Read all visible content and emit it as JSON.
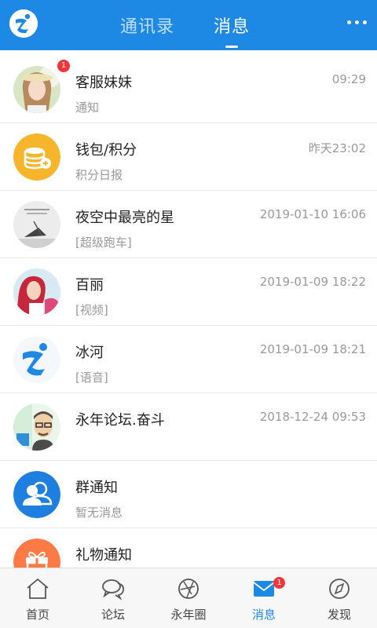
{
  "header": {
    "tabs": [
      {
        "label": "通讯录",
        "active": false
      },
      {
        "label": "消息",
        "active": true
      }
    ],
    "more_icon": "more-dots-icon",
    "accent_color": "#1e88e5"
  },
  "messages": [
    {
      "name": "客服妹妹",
      "time": "09:29",
      "preview": "通知",
      "badge": "1",
      "avatar": "girl-photo"
    },
    {
      "name": "钱包/积分",
      "time": "昨天23:02",
      "preview": "积分日报",
      "avatar": "wallet-coins-icon"
    },
    {
      "name": "夜空中最亮的星",
      "time": "2019-01-10 16:06",
      "preview": "[超级跑车]",
      "avatar": "sketch-photo"
    },
    {
      "name": "百丽",
      "time": "2019-01-09 18:22",
      "preview": "[视频]",
      "avatar": "woman-photo"
    },
    {
      "name": "冰河",
      "time": "2019-01-09 18:21",
      "preview": "[语音]",
      "avatar": "app-logo"
    },
    {
      "name": "永年论坛.奋斗",
      "time": "2018-12-24 09:53",
      "preview": "",
      "avatar": "man-cartoon"
    },
    {
      "name": "群通知",
      "time": "",
      "preview": "暂无消息",
      "avatar": "group-people-icon"
    },
    {
      "name": "礼物通知",
      "time": "",
      "preview": "",
      "avatar": "gift-icon"
    }
  ],
  "bottom_nav": [
    {
      "label": "首页",
      "icon": "home-icon",
      "active": false
    },
    {
      "label": "论坛",
      "icon": "chat-bubbles-icon",
      "active": false
    },
    {
      "label": "永年圈",
      "icon": "aperture-icon",
      "active": false
    },
    {
      "label": "消息",
      "icon": "message-icon",
      "active": true,
      "badge": "1"
    },
    {
      "label": "发现",
      "icon": "compass-icon",
      "active": false
    }
  ]
}
